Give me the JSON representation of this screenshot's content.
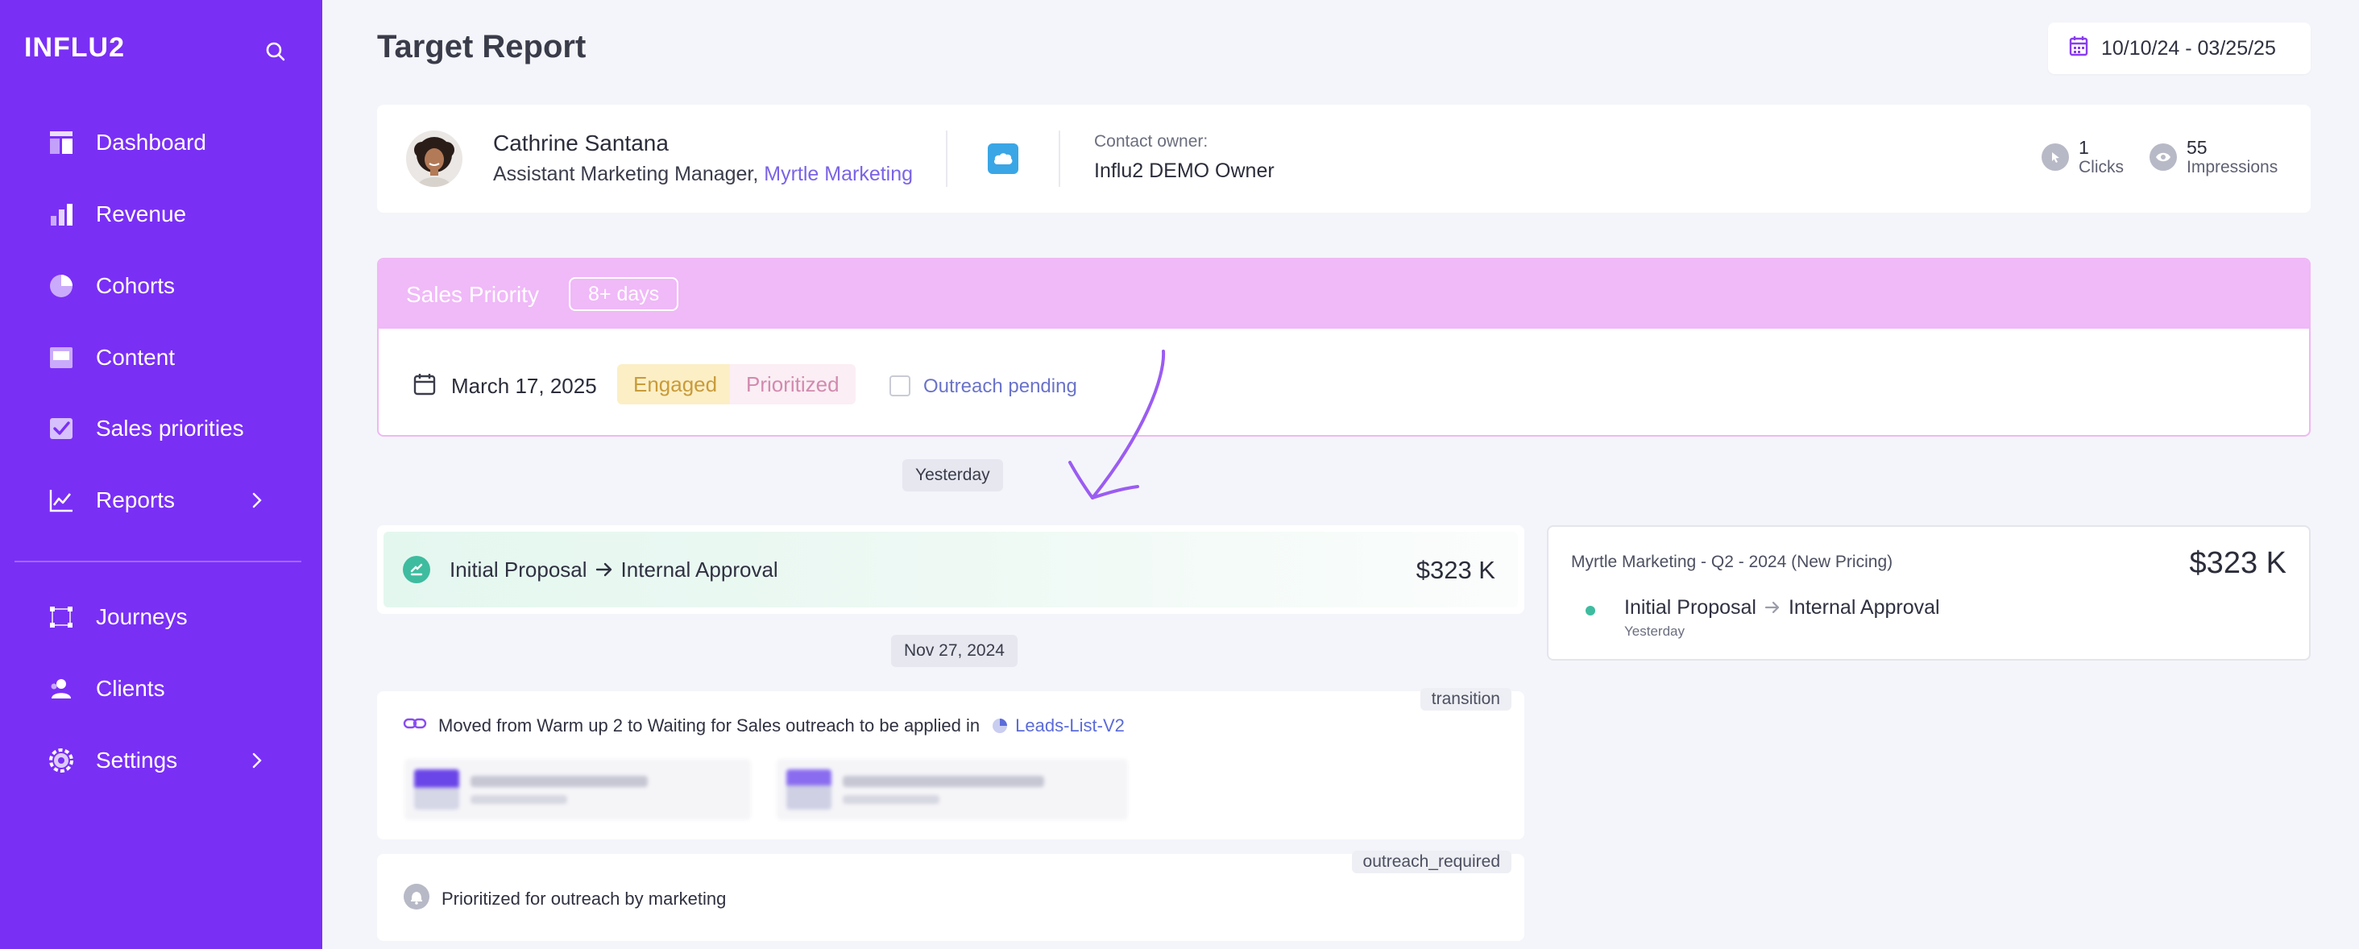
{
  "app": {
    "logo": "INFLU2"
  },
  "sidebar": {
    "items": [
      {
        "label": "Dashboard"
      },
      {
        "label": "Revenue"
      },
      {
        "label": "Cohorts"
      },
      {
        "label": "Content"
      },
      {
        "label": "Sales priorities"
      },
      {
        "label": "Reports"
      },
      {
        "label": "Journeys"
      },
      {
        "label": "Clients"
      },
      {
        "label": "Settings"
      }
    ]
  },
  "header": {
    "title": "Target Report",
    "date_range": "10/10/24 - 03/25/25"
  },
  "contact": {
    "name": "Cathrine Santana",
    "role": "Assistant Marketing Manager,",
    "company": "Myrtle Marketing",
    "owner_label": "Contact owner:",
    "owner_name": "Influ2 DEMO Owner",
    "clicks_value": "1",
    "clicks_label": "Clicks",
    "impressions_value": "55",
    "impressions_label": "Impressions"
  },
  "priority": {
    "title": "Sales Priority",
    "days_badge": "8+ days",
    "date": "March 17, 2025",
    "tag_engaged": "Engaged",
    "tag_prioritized": "Prioritized",
    "outreach_label": "Outreach pending",
    "outreach_checked": false
  },
  "timeline": {
    "date_yesterday": "Yesterday",
    "date_nov": "Nov 27, 2024",
    "transition": {
      "from": "Initial Proposal",
      "to": "Internal Approval",
      "amount": "$323 K"
    },
    "event_transition": {
      "tag": "transition",
      "text": "Moved from Warm up 2 to Waiting for Sales outreach to be applied in",
      "link": "Leads-List-V2"
    },
    "event_outreach": {
      "tag": "outreach_required",
      "text": "Prioritized for outreach by marketing"
    }
  },
  "deal": {
    "title": "Myrtle Marketing - Q2 - 2024 (New Pricing)",
    "amount": "$323 K",
    "stage_from": "Initial Proposal",
    "stage_to": "Internal Approval",
    "when": "Yesterday"
  },
  "colors": {
    "sidebar_bg": "#7a2ff5",
    "priority_head": "#f0b9f8",
    "accent_green": "#3ebc9f",
    "link": "#5a6bd9"
  }
}
